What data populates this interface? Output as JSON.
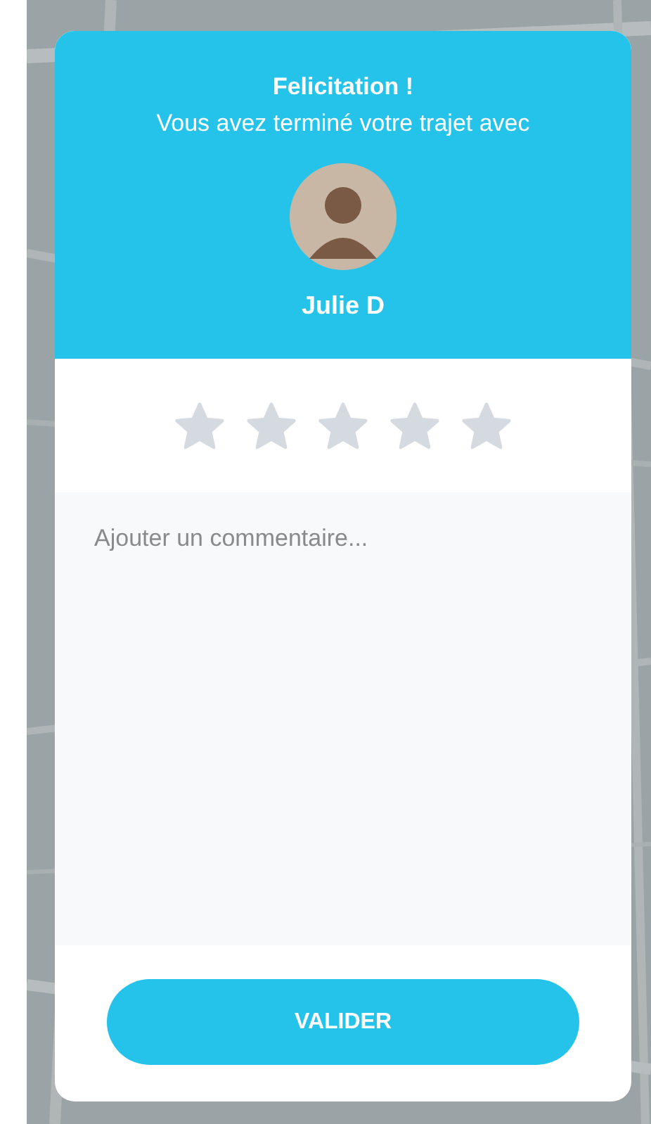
{
  "dialog": {
    "title": "Felicitation !",
    "message": "Vous avez terminé votre trajet avec",
    "driver_name": "Julie D",
    "rating": {
      "stars": 0
    },
    "comment": {
      "placeholder": "Ajouter un commentaire..."
    },
    "submit_button": "VALIDER"
  }
}
